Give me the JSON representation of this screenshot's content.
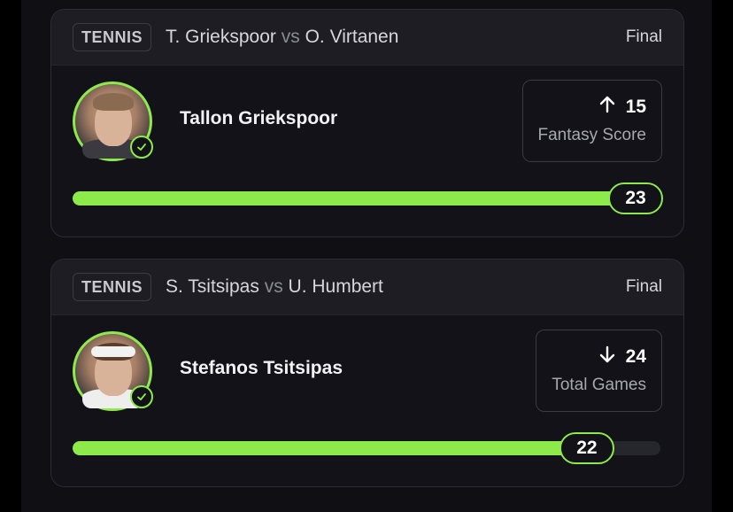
{
  "cards": [
    {
      "sport": "TENNIS",
      "player1": "T. Griekspoor",
      "vs": "vs",
      "player2": "O. Virtanen",
      "status": "Final",
      "player_name": "Tallon Griekspoor",
      "stat_direction": "up",
      "stat_value": "15",
      "stat_label": "Fantasy Score",
      "result": "23",
      "progress_fraction": 1.0
    },
    {
      "sport": "TENNIS",
      "player1": "S. Tsitsipas",
      "vs": "vs",
      "player2": "U. Humbert",
      "status": "Final",
      "player_name": "Stefanos Tsitsipas",
      "stat_direction": "down",
      "stat_value": "24",
      "stat_label": "Total Games",
      "result": "22",
      "progress_fraction": 0.917
    }
  ],
  "colors": {
    "accent": "#8ee94a",
    "card_bg": "#121218",
    "header_bg": "#1d1d23"
  },
  "icons": [
    "check-icon",
    "arrow-up-icon",
    "arrow-down-icon"
  ]
}
